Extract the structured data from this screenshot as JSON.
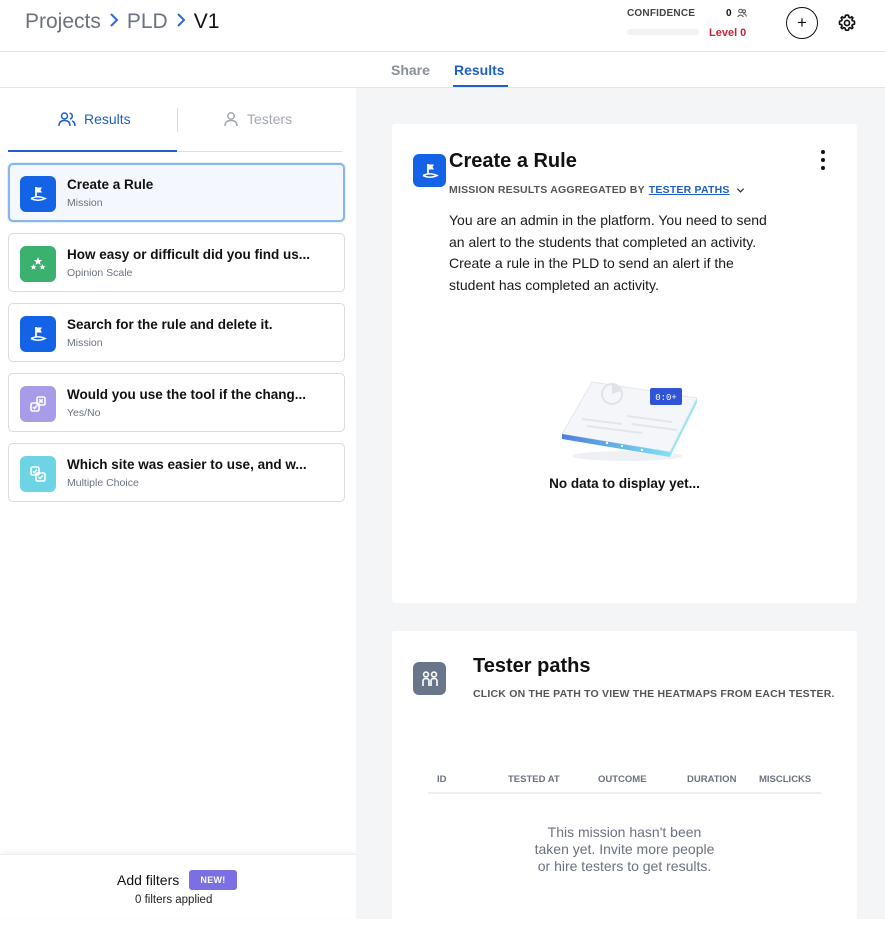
{
  "breadcrumb": {
    "items": [
      "Projects",
      "PLD"
    ],
    "current": "V1"
  },
  "confidence": {
    "label": "CONFIDENCE",
    "count": "0",
    "level": "Level 0",
    "progress": 0
  },
  "header": {
    "add_label": "+",
    "icons": [
      "users-icon",
      "plus-icon",
      "gear-icon"
    ]
  },
  "tabs": [
    {
      "label": "Share",
      "active": false
    },
    {
      "label": "Results",
      "active": true
    }
  ],
  "subtabs": [
    {
      "label": "Results",
      "active": true
    },
    {
      "label": "Testers",
      "active": false
    }
  ],
  "tasks": [
    {
      "title": "Create a Rule",
      "type": "Mission",
      "color": "#1463e6",
      "icon": "flag-icon",
      "active": true
    },
    {
      "title": "How easy or difficult did you find us...",
      "type": "Opinion Scale",
      "color": "#3ab16e",
      "icon": "stars-icon",
      "active": false
    },
    {
      "title": "Search for the rule and delete it.",
      "type": "Mission",
      "color": "#1463e6",
      "icon": "flag-icon",
      "active": false
    },
    {
      "title": "Would you use the tool if the chang...",
      "type": "Yes/No",
      "color": "#a89be8",
      "icon": "yes-no-icon",
      "active": false
    },
    {
      "title": "Which site was easier to use, and w...",
      "type": "Multiple Choice",
      "color": "#6fd3e6",
      "icon": "multiple-choice-icon",
      "active": false
    }
  ],
  "filters": {
    "label": "Add filters",
    "badge": "NEW!",
    "count_text": "0 filters applied"
  },
  "mission_panel": {
    "title": "Create a Rule",
    "meta_prefix": "MISSION RESULTS AGGREGATED BY",
    "meta_link": "TESTER PATHS",
    "description": "You are an admin in the platform. You need to send an alert to the students that completed an activity. Create a rule in the PLD to send an alert if the student has completed an activity.",
    "illustration_time": "0:0+",
    "empty_text": "No data to display yet..."
  },
  "paths_panel": {
    "title": "Tester paths",
    "subtitle": "CLICK ON THE PATH TO VIEW THE HEATMAPS FROM EACH TESTER.",
    "columns": [
      "ID",
      "TESTED AT",
      "OUTCOME",
      "DURATION",
      "MISCLICKS"
    ],
    "empty_text": "This mission hasn't been taken yet. Invite more people or hire testers to get results."
  }
}
